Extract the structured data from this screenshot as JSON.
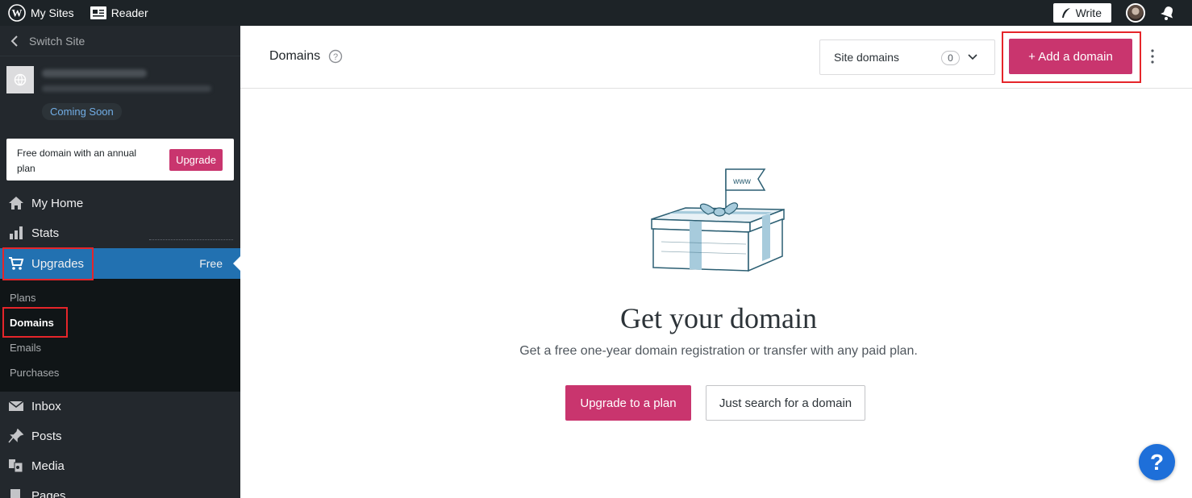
{
  "masterbar": {
    "my_sites": "My Sites",
    "reader": "Reader",
    "write": "Write"
  },
  "sidebar": {
    "switch_site": "Switch Site",
    "site_badge": "Coming Soon",
    "promo_text": "Free domain with an annual plan",
    "promo_button": "Upgrade",
    "items": [
      {
        "label": "My Home",
        "icon": "home-icon"
      },
      {
        "label": "Stats",
        "icon": "stats-icon"
      },
      {
        "label": "Upgrades",
        "icon": "cart-icon",
        "badge": "Free",
        "active": true
      },
      {
        "label": "Inbox",
        "icon": "inbox-icon"
      },
      {
        "label": "Posts",
        "icon": "pin-icon"
      },
      {
        "label": "Media",
        "icon": "media-icon"
      },
      {
        "label": "Pages",
        "icon": "pages-icon"
      }
    ],
    "submenu": [
      {
        "label": "Plans"
      },
      {
        "label": "Domains",
        "active": true
      },
      {
        "label": "Emails"
      },
      {
        "label": "Purchases"
      }
    ]
  },
  "header": {
    "title": "Domains",
    "filter_label": "Site domains",
    "filter_count": "0",
    "add_button": "+ Add a domain"
  },
  "main": {
    "illustration_label": "www",
    "headline": "Get your domain",
    "subtext": "Get a free one-year domain registration or transfer with any paid plan.",
    "primary_button": "Upgrade to a plan",
    "secondary_button": "Just search for a domain"
  },
  "help": {
    "label": "?"
  },
  "colors": {
    "accent": "#c9356e",
    "sidebar_bg": "#23282d",
    "active_bg": "#2271b1",
    "highlight": "#e5252a",
    "help_bg": "#1e6fd9"
  }
}
